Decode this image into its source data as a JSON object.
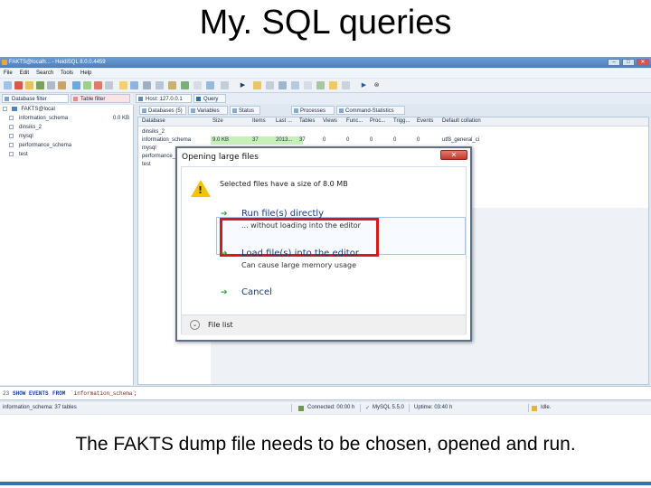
{
  "slide": {
    "title": "My. SQL queries",
    "caption": "The FAKTS dump file needs to be chosen, opened and run."
  },
  "window": {
    "title": "FAKTS@localh... - HeidiSQL 8.0.0.4459",
    "controls": [
      "–",
      "□",
      "✕"
    ]
  },
  "menu": [
    "File",
    "Edit",
    "Search",
    "Tools",
    "Help"
  ],
  "left_panel": {
    "tabs": [
      "Database filter",
      "Table filter"
    ],
    "root": "FAKTS@local",
    "databases": [
      {
        "name": "information_schema",
        "size": "0.0 KB"
      },
      {
        "name": "dinsiks_2",
        "size": ""
      },
      {
        "name": "mysql",
        "size": ""
      },
      {
        "name": "performance_schema",
        "size": ""
      },
      {
        "name": "test",
        "size": ""
      }
    ]
  },
  "main_tabs": [
    "Host: 127.0.0.1",
    "Query"
  ],
  "sub_tabs": [
    "Databases (5)",
    "Variables",
    "Status",
    "Processes",
    "Command-Statistics"
  ],
  "grid": {
    "columns": [
      "Database",
      "Size",
      "Items",
      "Last ...",
      "Tables",
      "Views",
      "Func...",
      "Proc...",
      "Trigg...",
      "Events",
      "Default collation"
    ],
    "rows": [
      [
        "dinsiks_2"
      ],
      [
        "information_schema",
        "9.0 KB",
        "37",
        "2013...",
        "37",
        "0",
        "0",
        "0",
        "0",
        "0",
        "utf8_general_ci"
      ],
      [
        "mysql"
      ],
      [
        "performance_schema"
      ],
      [
        "test"
      ]
    ]
  },
  "query_bar": {
    "line": "23",
    "sql": [
      "SHOW",
      "EVENTS",
      "FROM",
      "`information_schema`",
      ";"
    ]
  },
  "statusbar": {
    "left": "information_schema: 37 tables",
    "connected": "Connected: 00:00 h",
    "server": "MySQL 5.5.0",
    "uptime": "Uptime: 03:40 h",
    "state": "Idle."
  },
  "dialog": {
    "title": "Opening large files",
    "close": "✕",
    "message": "Selected files have a size of 8.0 MB",
    "options": [
      {
        "main": "Run file(s) directly",
        "sub": "... without loading into the editor"
      },
      {
        "main": "Load file(s) into the editor",
        "sub": "Can cause large memory usage"
      },
      {
        "main": "Cancel",
        "sub": ""
      }
    ],
    "footer": "File list"
  },
  "colors": {
    "highlight_box": "#d7191c",
    "green_arrow": "#2f9e3a",
    "warning": "#f3c300",
    "selected_cells": "#c7f0b8"
  }
}
